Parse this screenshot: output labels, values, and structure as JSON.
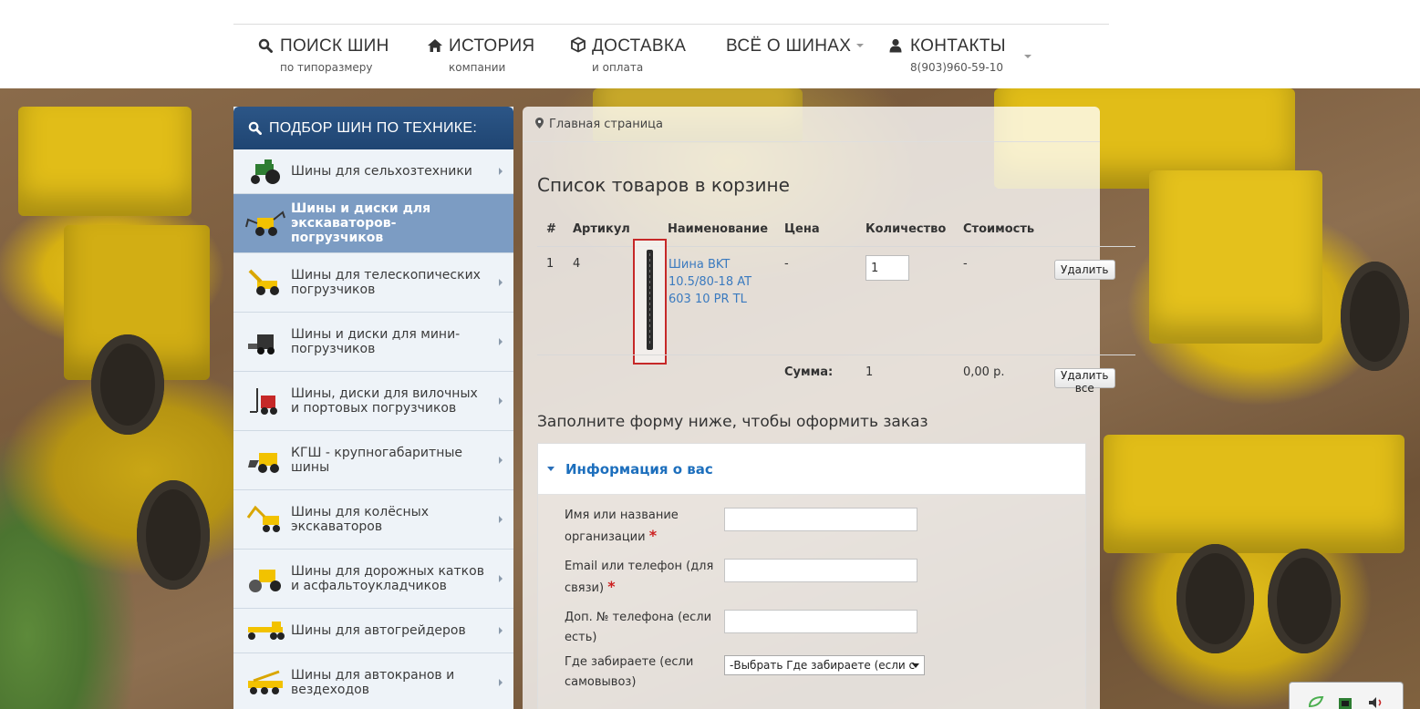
{
  "nav": {
    "items": [
      {
        "label": "ПОИСК ШИН",
        "sub": "по типоразмеру",
        "icon": "search-icon",
        "caret": false
      },
      {
        "label": "ИСТОРИЯ",
        "sub": "компании",
        "icon": "home-icon",
        "caret": false
      },
      {
        "label": "ДОСТАВКА",
        "sub": "и оплата",
        "icon": "box-icon",
        "caret": false
      },
      {
        "label": "ВСЁ О ШИНАХ",
        "sub": "",
        "icon": "",
        "caret": true
      },
      {
        "label": "КОНТАКТЫ",
        "sub": "8(903)960-59-10",
        "icon": "user-icon",
        "caret": true
      }
    ]
  },
  "sidebar": {
    "title": "ПОДБОР ШИН ПО ТЕХНИКЕ:",
    "items": [
      {
        "label": "Шины для сельхозтехники",
        "active": false
      },
      {
        "label": "Шины и диски для экскаваторов-погрузчиков",
        "active": true
      },
      {
        "label": "Шины для телескопических погрузчиков",
        "active": false
      },
      {
        "label": "Шины и диски для мини-погрузчиков",
        "active": false
      },
      {
        "label": "Шины, диски для вилочных и портовых погрузчиков",
        "active": false
      },
      {
        "label": "КГШ - крупногабаритные шины",
        "active": false
      },
      {
        "label": "Шины для колёсных экскаваторов",
        "active": false
      },
      {
        "label": "Шины для дорожных катков и асфальтоукладчиков",
        "active": false
      },
      {
        "label": "Шины для автогрейдеров",
        "active": false
      },
      {
        "label": "Шины для автокранов и вездеходов",
        "active": false
      }
    ]
  },
  "breadcrumb": {
    "home": "Главная страница"
  },
  "cart": {
    "title": "Список товаров в корзине",
    "headers": {
      "num": "#",
      "sku": "Артикул",
      "name": "Наименование",
      "price": "Цена",
      "qty": "Количество",
      "cost": "Стоимость"
    },
    "rows": [
      {
        "num": "1",
        "sku": "4",
        "name": "Шина BKT 10.5/80-18 AT 603 10 PR TL",
        "price": "-",
        "qty": "1",
        "cost": "-",
        "delete_label": "Удалить"
      }
    ],
    "total": {
      "label": "Сумма:",
      "qty": "1",
      "cost": "0,00 р.",
      "delete_all_label": "Удалить все"
    }
  },
  "order_form": {
    "title": "Заполните форму ниже, чтобы оформить заказ",
    "section_title": "Информация о вас",
    "fields": [
      {
        "label": "Имя или название организации",
        "required": true
      },
      {
        "label": "Email или телефон (для связи)",
        "required": true
      },
      {
        "label": "Доп. № телефона (если есть)",
        "required": false
      },
      {
        "label": "Где забираете (если самовывоз)",
        "required": false,
        "select_value": "-Выбрать Где забираете (если с"
      }
    ]
  },
  "colors": {
    "sidebar_header": "#1f4572",
    "sidebar_active": "#7c9cc3",
    "link": "#3a7abf",
    "section_title": "#1d6fbd",
    "required": "#cc1f1f"
  }
}
